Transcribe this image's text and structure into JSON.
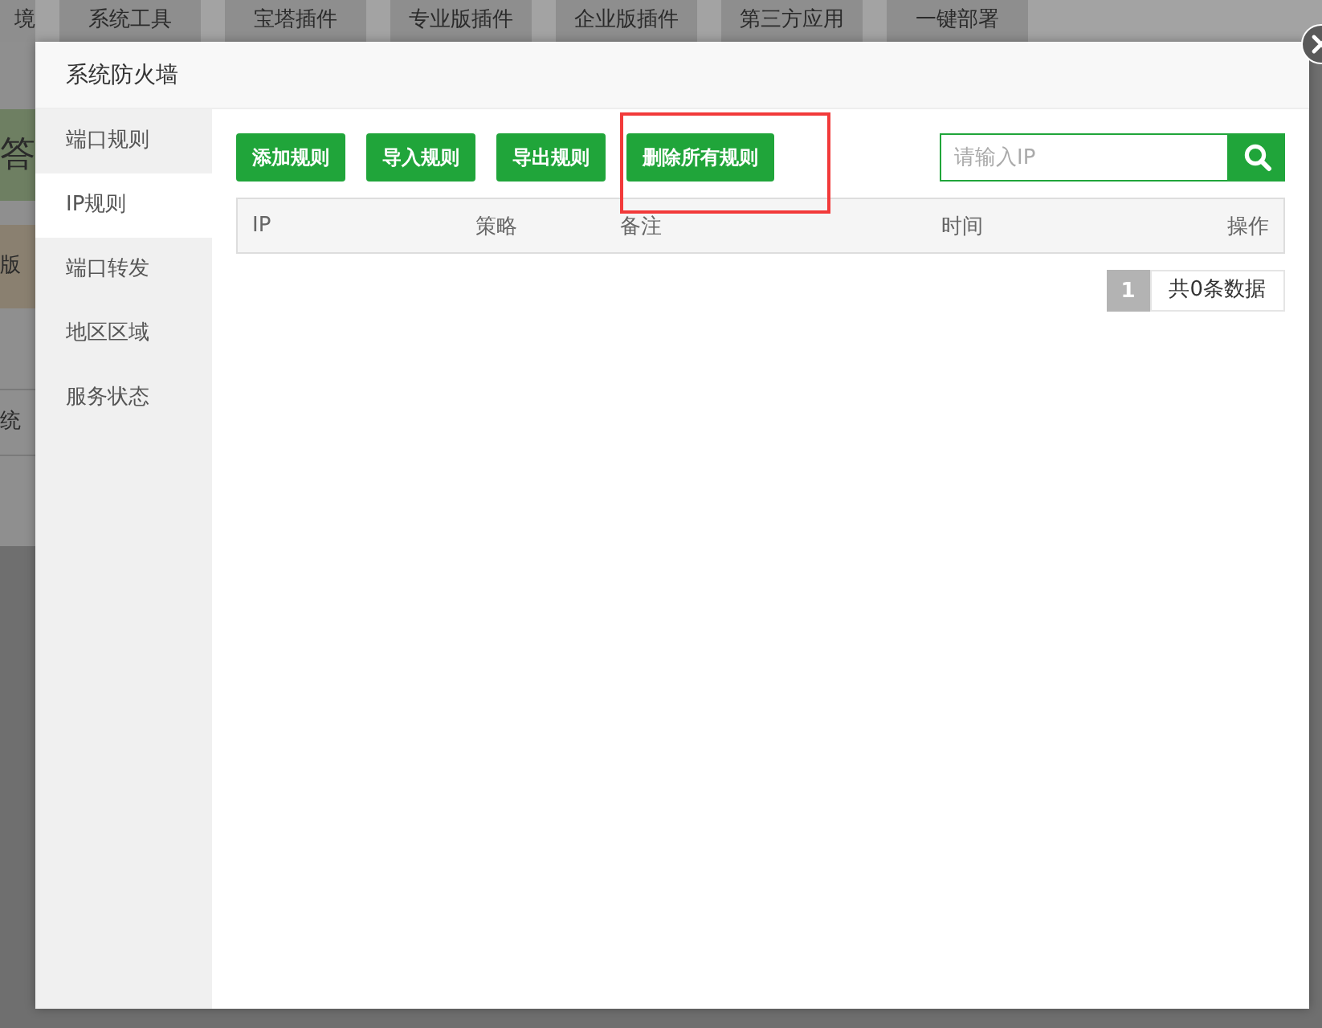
{
  "background": {
    "tabs": [
      {
        "label": "境"
      },
      {
        "label": "系统工具"
      },
      {
        "label": "宝塔插件"
      },
      {
        "label": "专业版插件"
      },
      {
        "label": "企业版插件"
      },
      {
        "label": "第三方应用"
      },
      {
        "label": "一键部署"
      }
    ],
    "side_texts": [
      {
        "kind": "banner",
        "label": "答"
      },
      {
        "kind": "card",
        "label": "版"
      },
      {
        "kind": "row",
        "label": "统"
      }
    ]
  },
  "dialog": {
    "title": "系统防火墙",
    "sidebar": {
      "items": [
        {
          "label": "端口规则",
          "selected": false
        },
        {
          "label": "IP规则",
          "selected": true
        },
        {
          "label": "端口转发",
          "selected": false
        },
        {
          "label": "地区区域",
          "selected": false
        },
        {
          "label": "服务状态",
          "selected": false
        }
      ]
    },
    "toolbar": {
      "buttons": [
        "添加规则",
        "导入规则",
        "导出规则",
        "删除所有规则"
      ]
    },
    "annotation": {
      "kind": "highlight-box"
    },
    "search": {
      "placeholder": "请输入IP"
    },
    "table": {
      "columns": [
        "IP",
        "策略",
        "备注",
        "时间",
        "操作"
      ]
    },
    "pagination": {
      "pages": [
        {
          "label": "1",
          "selected": true
        }
      ],
      "total": "共0条数据"
    }
  }
}
